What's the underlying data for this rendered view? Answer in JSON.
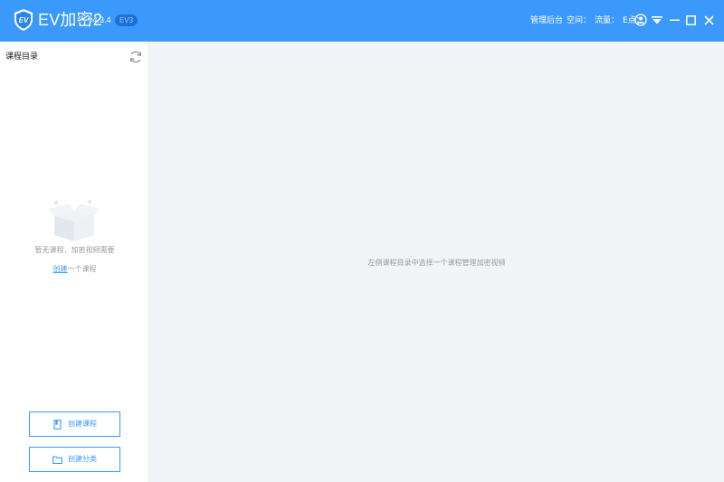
{
  "titlebar": {
    "app_name": "EV加密2",
    "version": "v4.3.4",
    "edition_badge": "EV3",
    "status": {
      "admin": "管理后台",
      "space": "空间：",
      "traffic": "流量：",
      "epoints": "E点："
    },
    "accent_color": "#3b99fc"
  },
  "sidebar": {
    "title": "课程目录",
    "empty_message": "暂无课程，加密视频需要",
    "create_link": "创建",
    "create_suffix": "一个课程",
    "buttons": {
      "create_course": "创建课程",
      "create_category": "创建分类"
    }
  },
  "main": {
    "hint": "左侧课程目录中选择一个课程管理加密视频"
  }
}
